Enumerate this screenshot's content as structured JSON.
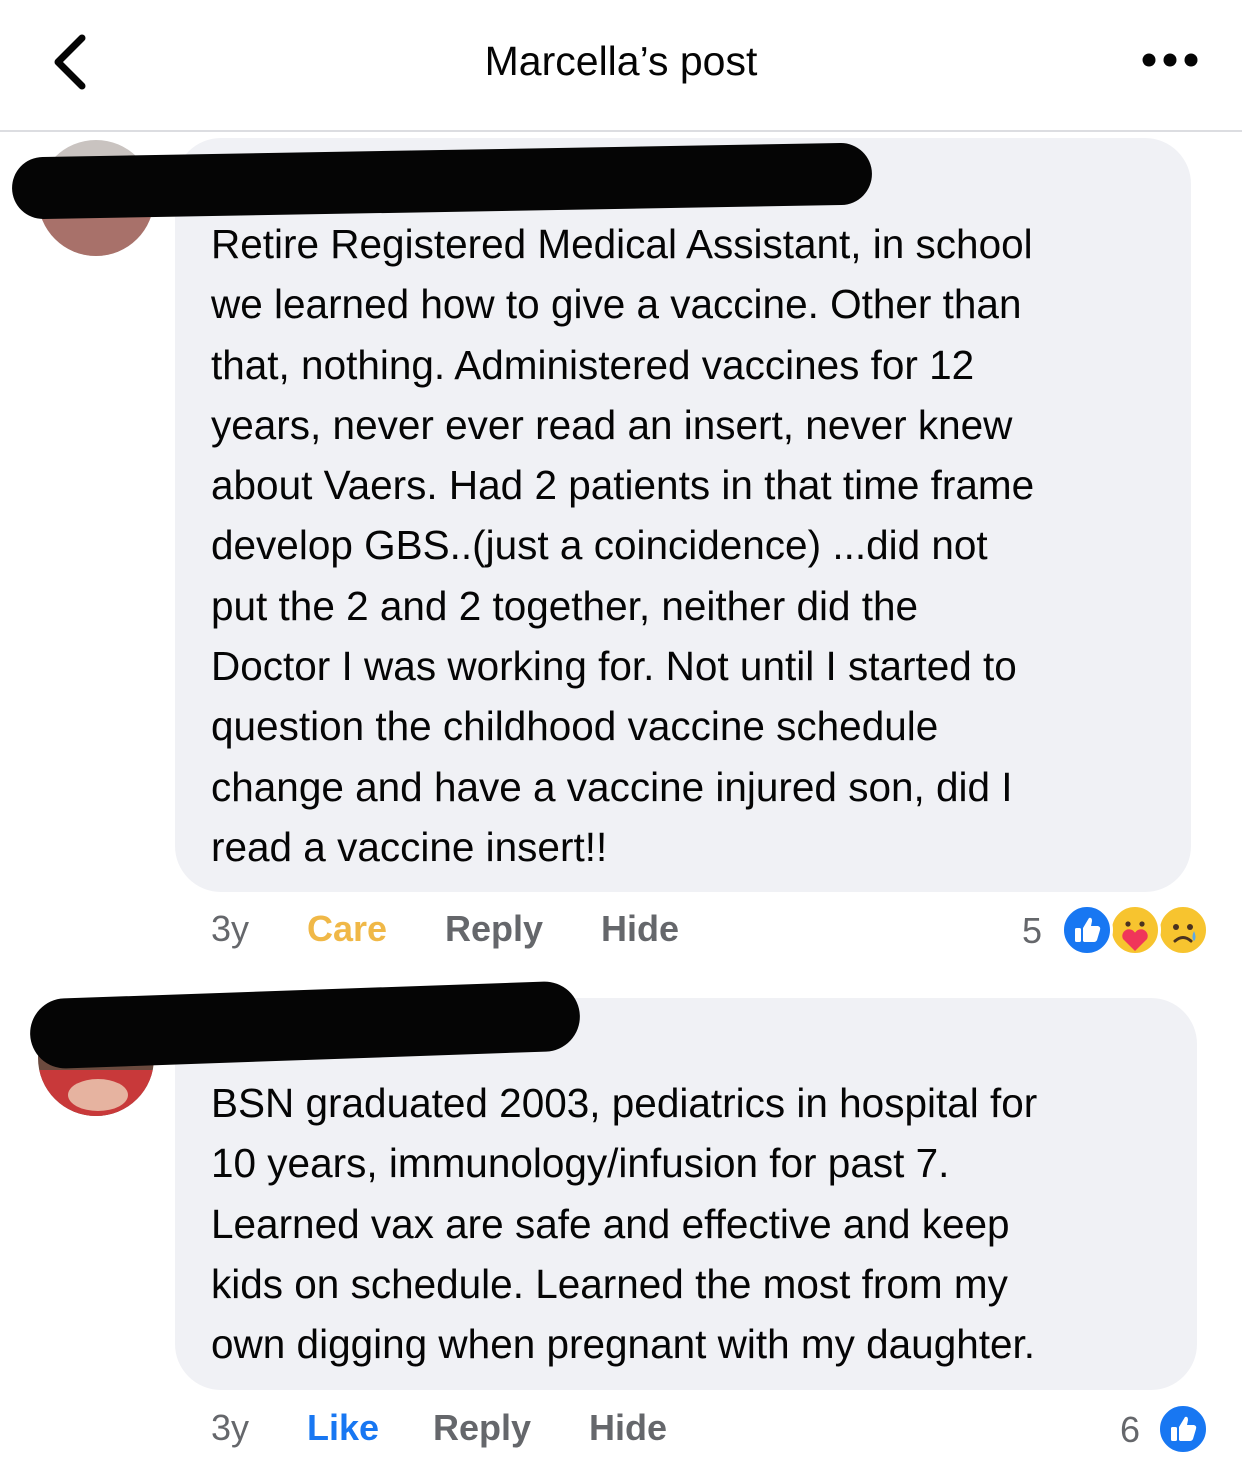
{
  "header": {
    "title": "Marcella’s post",
    "back_icon": "chevron-left-icon",
    "more_icon": "more-dots-icon"
  },
  "comments": [
    {
      "body": "Retire Registered Medical Assistant, in school\nwe learned how to give a vaccine. Other than\nthat, nothing. Administered vaccines for 12\nyears, never ever read an insert, never knew\nabout Vaers. Had 2 patients in that time frame\ndevelop GBS..(just a coincidence) ...did not\nput the 2 and 2 together, neither did the\nDoctor I was working for. Not until I started to\nquestion the childhood vaccine schedule\nchange and have a vaccine injured son, did I\nread a vaccine insert!!",
      "time": "3y",
      "reaction_label": "Care",
      "reply_label": "Reply",
      "hide_label": "Hide",
      "reaction_count": "5",
      "reaction_icons": [
        "like-icon",
        "care-icon",
        "sad-icon"
      ]
    },
    {
      "body": "BSN graduated 2003, pediatrics in hospital for\n10 years, immunology/infusion for past 7.\nLearned vax are safe and effective and keep\nkids on schedule.  Learned the most from my\nown digging when pregnant with my daughter.",
      "time": "3y",
      "reaction_label": "Like",
      "reply_label": "Reply",
      "hide_label": "Hide",
      "reaction_count": "6",
      "reaction_icons": [
        "like-icon"
      ]
    }
  ],
  "colors": {
    "like_blue": "#1877f2",
    "care_yellow": "#f0b847",
    "muted_gray": "#65676b",
    "bubble_bg": "#f0f1f5"
  }
}
